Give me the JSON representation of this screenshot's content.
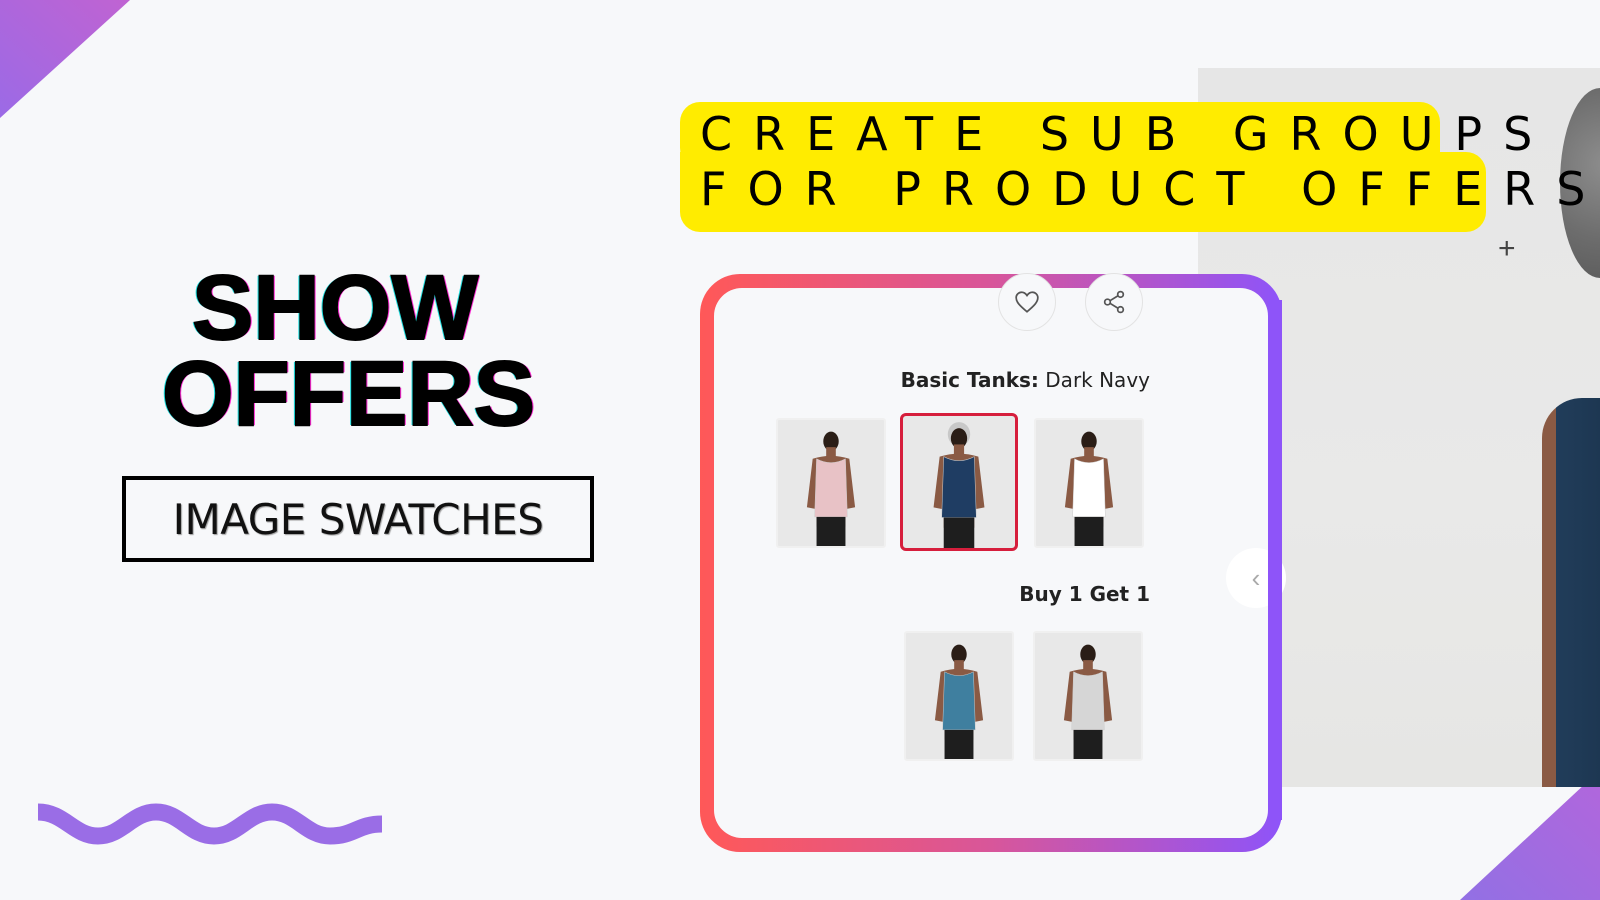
{
  "banner": {
    "line1": "CREATE SUB GROUPS",
    "line2": "FOR PRODUCT OFFERS",
    "color": "#ffec00"
  },
  "headline": {
    "line1": "SHOW",
    "line2": "OFFERS"
  },
  "feature_label": "IMAGE SWATCHES",
  "colors": {
    "background": "#f7f8fa",
    "accent_purple": "#9a6de6",
    "frame_gradient_start": "#ff5858",
    "frame_gradient_end": "#8e54f9",
    "selected_border": "#d61e3c"
  },
  "product": {
    "actions": [
      {
        "name": "wishlist",
        "icon": "heart-icon"
      },
      {
        "name": "share",
        "icon": "share-icon"
      }
    ],
    "groups": [
      {
        "title_bold": "Basic Tanks:",
        "title_value": "Dark Navy",
        "swatches": [
          {
            "color_name": "Pink",
            "tank_color": "#e8c2c6",
            "selected": false
          },
          {
            "color_name": "Dark Navy",
            "tank_color": "#1f3d63",
            "selected": true
          },
          {
            "color_name": "White",
            "tank_color": "#ffffff",
            "selected": false
          }
        ]
      },
      {
        "title_bold": "Buy 1 Get 1",
        "title_value": "",
        "swatches": [
          {
            "color_name": "Blue",
            "tank_color": "#3f7f9f",
            "selected": false
          },
          {
            "color_name": "Light Grey",
            "tank_color": "#d6d6d6",
            "selected": false
          }
        ]
      }
    ],
    "carousel_prev_icon": "chevron-left-icon"
  },
  "photo": {
    "zoom_icon": "plus-icon",
    "zoom_symbol": "+"
  }
}
